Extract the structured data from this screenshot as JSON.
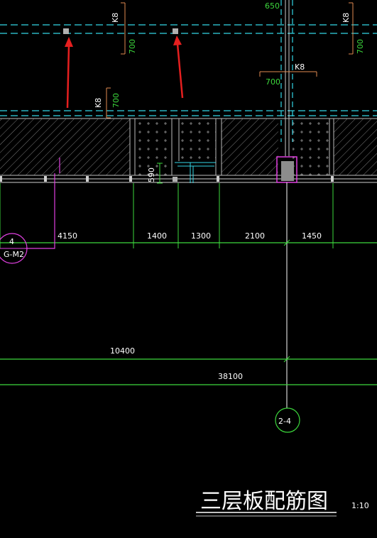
{
  "drawing": {
    "title": "三层板配筋图",
    "scale": "1:10"
  },
  "rebar_labels": {
    "k8_top_left": "K8",
    "v700_top_left": "700",
    "k8_top_right": "K8",
    "v700_top_right": "700",
    "v650_top": "650",
    "k8_mid": "K8",
    "v700_mid": "700",
    "k8_left": "K8",
    "v700_left": "700",
    "v590": "590"
  },
  "dimensions": {
    "segments": [
      "4150",
      "1400",
      "1300",
      "2100",
      "1450"
    ],
    "subtotal": "10400",
    "total": "38100"
  },
  "axis_markers": {
    "left_num": "4",
    "left_sub": "G-M2",
    "bottom": "2-4"
  },
  "colors": {
    "background": "#000000",
    "cyan_dash": "#33d6e6",
    "green": "#3cd83c",
    "magenta": "#e040e0",
    "red_arrow": "#e51f1f",
    "hatch": "#8a8a8a"
  }
}
